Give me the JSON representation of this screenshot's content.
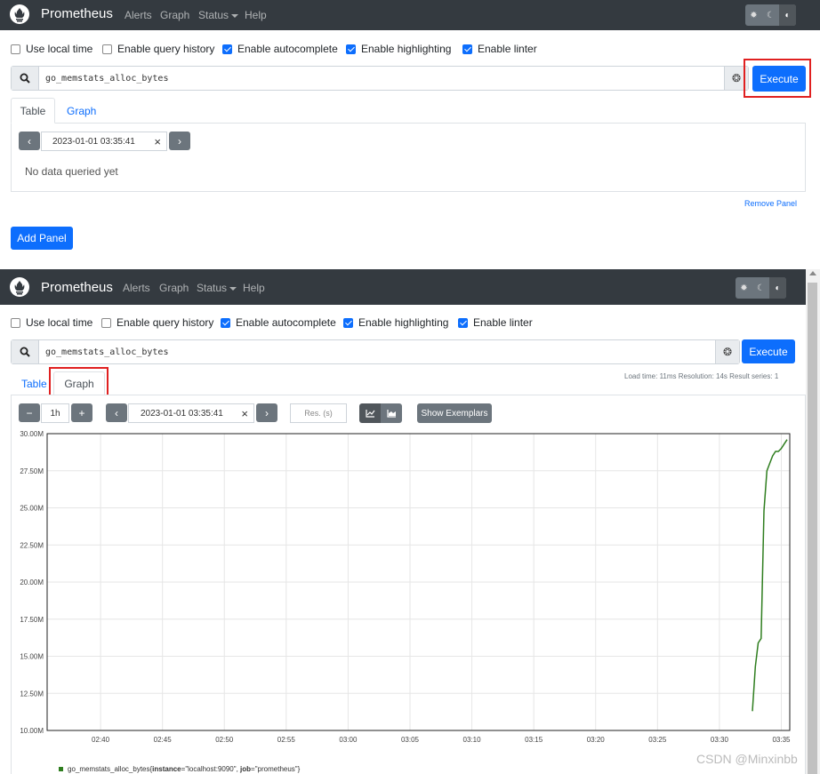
{
  "top": {
    "nav": {
      "brand": "Prometheus",
      "links": [
        "Alerts",
        "Graph",
        "Status",
        "Help"
      ],
      "theme_icons": [
        "sun-icon",
        "moon-icon",
        "contrast-icon"
      ]
    },
    "options": {
      "use_local_time": {
        "label": "Use local time",
        "checked": false
      },
      "enable_query_history": {
        "label": "Enable query history",
        "checked": false
      },
      "enable_autocomplete": {
        "label": "Enable autocomplete",
        "checked": true
      },
      "enable_highlighting": {
        "label": "Enable highlighting",
        "checked": true
      },
      "enable_linter": {
        "label": "Enable linter",
        "checked": true
      }
    },
    "query": "go_memstats_alloc_bytes",
    "execute_label": "Execute",
    "tabs": {
      "table": "Table",
      "graph": "Graph",
      "active": "Table"
    },
    "datetime": "2023-01-01 03:35:41",
    "clear_glyph": "×",
    "no_data": "No data queried yet",
    "remove_panel": "Remove Panel",
    "add_panel": "Add Panel"
  },
  "bottom": {
    "nav": {
      "brand": "Prometheus",
      "links": [
        "Alerts",
        "Graph",
        "Status",
        "Help"
      ]
    },
    "options": {
      "use_local_time": {
        "label": "Use local time",
        "checked": false
      },
      "enable_query_history": {
        "label": "Enable query history",
        "checked": false
      },
      "enable_autocomplete": {
        "label": "Enable autocomplete",
        "checked": true
      },
      "enable_highlighting": {
        "label": "Enable highlighting",
        "checked": true
      },
      "enable_linter": {
        "label": "Enable linter",
        "checked": true
      }
    },
    "query": "go_memstats_alloc_bytes",
    "execute_label": "Execute",
    "tabs": {
      "table": "Table",
      "graph": "Graph",
      "active": "Graph"
    },
    "stats": "Load time: 11ms   Resolution: 14s   Result series: 1",
    "range": "1h",
    "minus": "−",
    "plus": "+",
    "datetime": "2023-01-01 03:35:41",
    "clear_glyph": "×",
    "resolution_placeholder": "Res. (s)",
    "show_exemplars": "Show Exemplars",
    "legend_prefix": "go_memstats_alloc_bytes{",
    "legend_labels": [
      {
        "key": "instance",
        "value": "\"localhost:9090\""
      },
      {
        "key": "job",
        "value": "\"prometheus\""
      }
    ],
    "legend_suffix": "}"
  },
  "chart_data": {
    "type": "line",
    "title": "",
    "xlabel": "",
    "ylabel": "",
    "x_ticks": [
      "02:40",
      "02:45",
      "02:50",
      "02:55",
      "03:00",
      "03:05",
      "03:10",
      "03:15",
      "03:20",
      "03:25",
      "03:30",
      "03:35"
    ],
    "y_ticks": [
      "10.00M",
      "12.50M",
      "15.00M",
      "17.50M",
      "20.00M",
      "22.50M",
      "25.00M",
      "27.50M",
      "30.00M"
    ],
    "ylim": [
      10000000,
      30000000
    ],
    "xlim": [
      "02:35:41",
      "03:35:41"
    ],
    "grid": true,
    "series": [
      {
        "name": "go_memstats_alloc_bytes{instance=\"localhost:9090\", job=\"prometheus\"}",
        "color": "#2f7e1f",
        "x": [
          "03:32:40",
          "03:32:54",
          "03:33:08",
          "03:33:22",
          "03:33:36",
          "03:33:50",
          "03:34:04",
          "03:34:18",
          "03:34:32",
          "03:34:46",
          "03:35:00",
          "03:35:14",
          "03:35:28"
        ],
        "values": [
          11300000,
          14300000,
          15900000,
          16200000,
          24800000,
          27500000,
          28000000,
          28500000,
          28800000,
          28800000,
          29000000,
          29300000,
          29600000
        ]
      }
    ]
  },
  "watermark": "CSDN @Minxinbb"
}
